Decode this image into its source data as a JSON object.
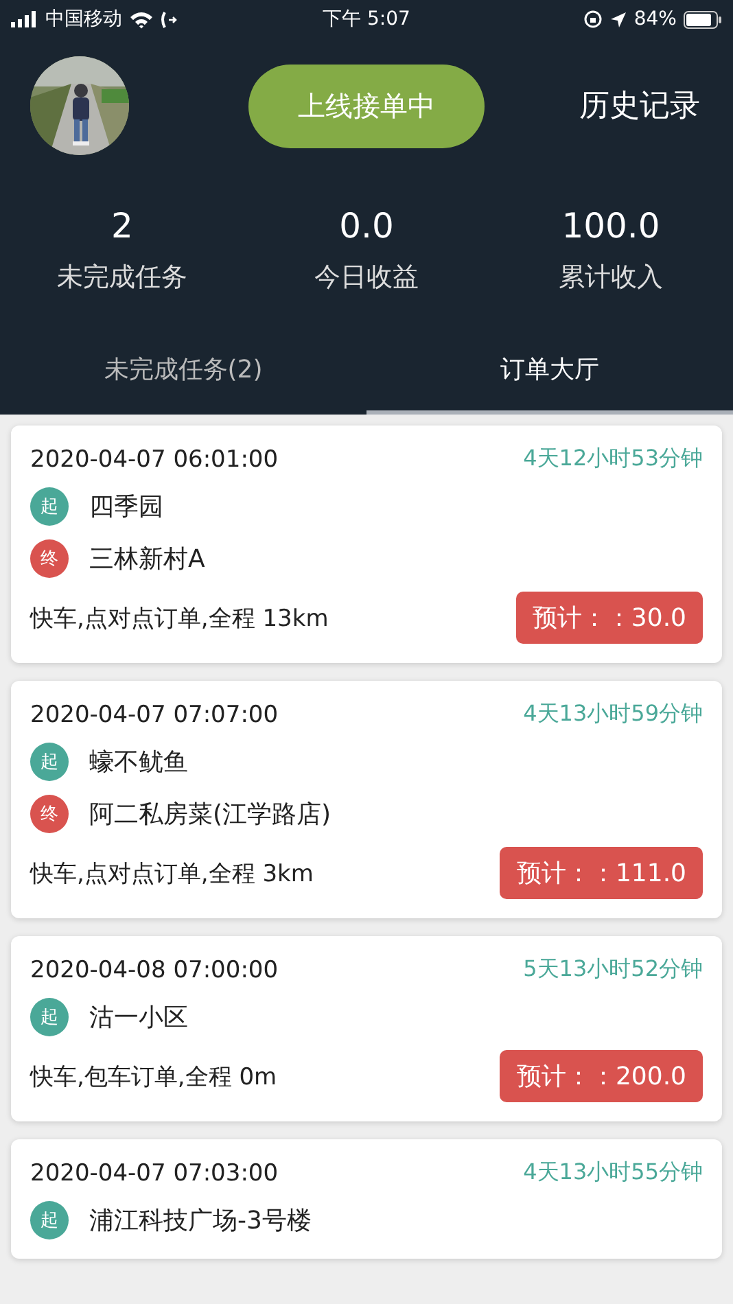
{
  "status_bar": {
    "carrier": "中国移动",
    "time": "下午 5:07",
    "battery": "84%"
  },
  "header": {
    "online_button": "上线接单中",
    "history_link": "历史记录"
  },
  "stats": [
    {
      "value": "2",
      "label": "未完成任务"
    },
    {
      "value": "0.0",
      "label": "今日收益"
    },
    {
      "value": "100.0",
      "label": "累计收入"
    }
  ],
  "tabs": [
    {
      "label": "未完成任务(2)",
      "selected": false
    },
    {
      "label": "订单大厅",
      "selected": true
    }
  ],
  "orders": [
    {
      "datetime": "2020-04-07 06:01:00",
      "countdown": "4天12小时53分钟",
      "stops": [
        {
          "kind": "start",
          "badge": "起",
          "place": "四季园"
        },
        {
          "kind": "end",
          "badge": "终",
          "place": "三林新村A"
        }
      ],
      "description": "快车,点对点订单,全程 13km",
      "price": "预计：：30.0"
    },
    {
      "datetime": "2020-04-07 07:07:00",
      "countdown": "4天13小时59分钟",
      "stops": [
        {
          "kind": "start",
          "badge": "起",
          "place": "蠔不鱿鱼"
        },
        {
          "kind": "end",
          "badge": "终",
          "place": "阿二私房菜(江学路店)"
        }
      ],
      "description": "快车,点对点订单,全程 3km",
      "price": "预计：：111.0"
    },
    {
      "datetime": "2020-04-08 07:00:00",
      "countdown": "5天13小时52分钟",
      "stops": [
        {
          "kind": "start",
          "badge": "起",
          "place": "沽一小区"
        }
      ],
      "description": "快车,包车订单,全程 0m",
      "price": "预计：：200.0"
    },
    {
      "datetime": "2020-04-07 07:03:00",
      "countdown": "4天13小时55分钟",
      "stops": [
        {
          "kind": "start",
          "badge": "起",
          "place": "浦江科技广场-3号楼"
        }
      ]
    }
  ]
}
